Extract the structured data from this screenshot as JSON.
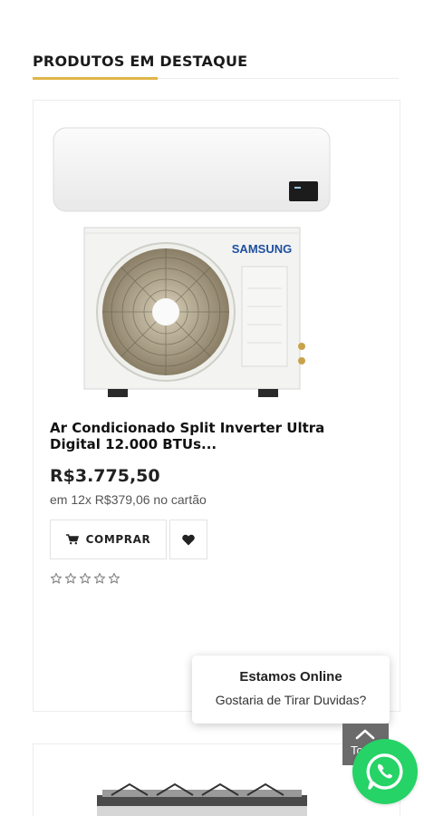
{
  "section": {
    "title": "PRODUTOS EM DESTAQUE",
    "accent_color": "#e0b64a"
  },
  "products": [
    {
      "name": "Ar Condicionado Split Inverter Ultra Digital 12.000 BTUs...",
      "brand_on_image": "SAMSUNG",
      "price": "R$3.775,50",
      "installments": "em 12x R$379,06 no cartão",
      "buy_label": "COMPRAR",
      "rating": 0,
      "rating_max": 5
    }
  ],
  "chat": {
    "title": "Estamos Online",
    "subtitle": "Gostaria de Tirar Duvidas?"
  },
  "back_to_top": {
    "label": "To"
  },
  "icons": {
    "buy": "cart-icon",
    "wishlist": "heart-icon",
    "whatsapp": "whatsapp-icon",
    "back_to_top": "chevron-up-icon",
    "rating": "star-outline-icon"
  },
  "colors": {
    "whatsapp": "#25d366"
  }
}
